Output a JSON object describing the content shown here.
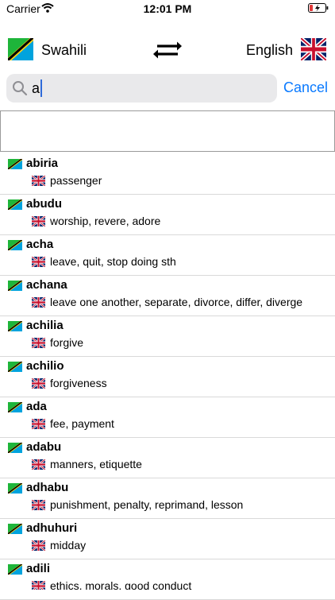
{
  "status_bar": {
    "carrier": "Carrier",
    "time": "12:01 PM"
  },
  "languages": {
    "from": "Swahili",
    "to": "English"
  },
  "search": {
    "value": "a",
    "cancel_label": "Cancel"
  },
  "entries": [
    {
      "swahili": "abiria",
      "english": "passenger"
    },
    {
      "swahili": "abudu",
      "english": "worship, revere, adore"
    },
    {
      "swahili": "acha",
      "english": "leave, quit, stop doing sth"
    },
    {
      "swahili": "achana",
      "english": "leave one another, separate, divorce, differ, diverge"
    },
    {
      "swahili": "achilia",
      "english": "forgive"
    },
    {
      "swahili": "achilio",
      "english": "forgiveness"
    },
    {
      "swahili": "ada",
      "english": "fee, payment"
    },
    {
      "swahili": "adabu",
      "english": "manners, etiquette"
    },
    {
      "swahili": "adhabu",
      "english": "punishment, penalty, reprimand, lesson"
    },
    {
      "swahili": "adhuhuri",
      "english": "midday"
    },
    {
      "swahili": "adili",
      "english": "ethics, morals, good conduct"
    }
  ],
  "colors": {
    "accent": "#0a7aff",
    "tz_green": "#1eb53a",
    "tz_blue": "#00a3dd",
    "tz_yellow": "#fcd116",
    "uk_blue": "#012169",
    "uk_red": "#c8102e"
  }
}
